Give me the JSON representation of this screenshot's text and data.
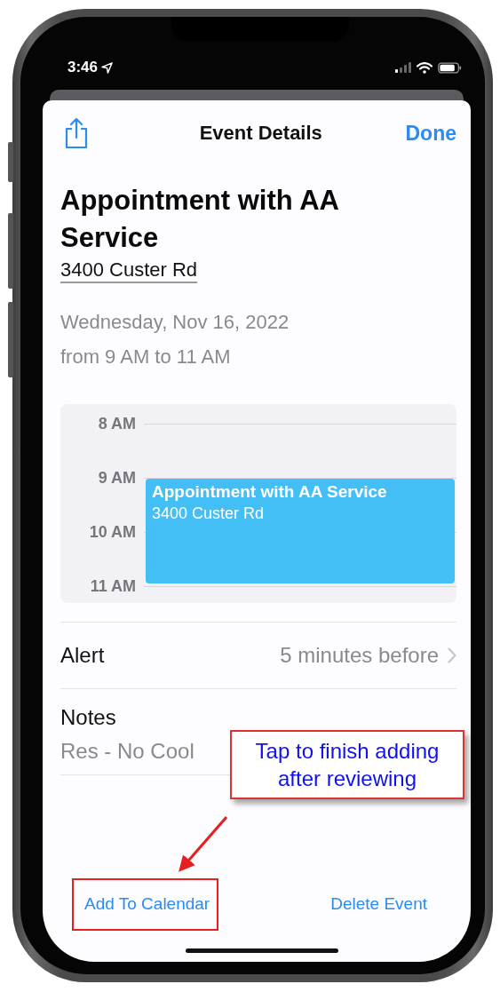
{
  "status_bar": {
    "time": "3:46"
  },
  "nav": {
    "title": "Event Details",
    "done": "Done"
  },
  "event": {
    "title": "Appointment with AA Service",
    "address": "3400 Custer Rd",
    "date": "Wednesday, Nov 16, 2022",
    "time_range": "from 9 AM to 11 AM"
  },
  "day_view": {
    "hours": [
      "8 AM",
      "9 AM",
      "10 AM",
      "11 AM"
    ],
    "event": {
      "title": "Appointment with AA Service",
      "location": "3400 Custer Rd"
    }
  },
  "rows": [
    {
      "kind": "alert",
      "label": "Alert",
      "value": "5 minutes before"
    },
    {
      "kind": "notes",
      "label": "Notes",
      "value": "Res - No Cool"
    }
  ],
  "actions": [
    {
      "label": "Add To Calendar",
      "highlighted": true
    },
    {
      "label": "Delete Event",
      "highlighted": false
    }
  ],
  "callout": {
    "text": "Tap to finish adding after reviewing"
  }
}
